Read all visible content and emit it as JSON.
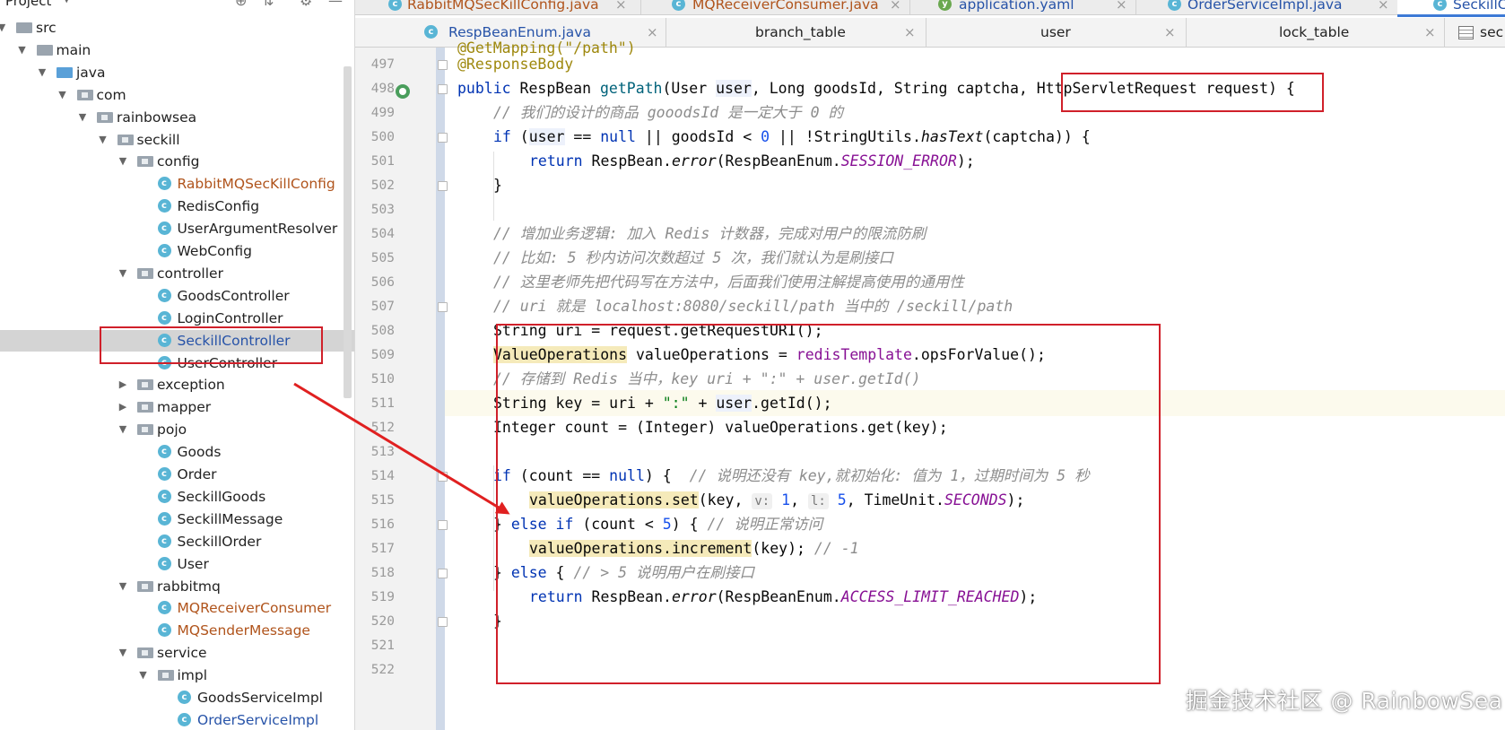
{
  "tree": {
    "header_label": "Project",
    "items": [
      {
        "label": "src",
        "type": "folder"
      },
      {
        "label": "main",
        "type": "folder"
      },
      {
        "label": "java",
        "type": "folder"
      },
      {
        "label": "com",
        "type": "package"
      },
      {
        "label": "rainbowsea",
        "type": "package"
      },
      {
        "label": "seckill",
        "type": "package"
      },
      {
        "label": "config",
        "type": "package"
      },
      {
        "label": "RabbitMQSecKillConfig",
        "type": "class"
      },
      {
        "label": "RedisConfig",
        "type": "class"
      },
      {
        "label": "UserArgumentResolver",
        "type": "class"
      },
      {
        "label": "WebConfig",
        "type": "class"
      },
      {
        "label": "controller",
        "type": "package"
      },
      {
        "label": "GoodsController",
        "type": "class"
      },
      {
        "label": "LoginController",
        "type": "class"
      },
      {
        "label": "SeckillController",
        "type": "class"
      },
      {
        "label": "UserController",
        "type": "class"
      },
      {
        "label": "exception",
        "type": "package"
      },
      {
        "label": "mapper",
        "type": "package"
      },
      {
        "label": "pojo",
        "type": "package"
      },
      {
        "label": "Goods",
        "type": "class"
      },
      {
        "label": "Order",
        "type": "class"
      },
      {
        "label": "SeckillGoods",
        "type": "class"
      },
      {
        "label": "SeckillMessage",
        "type": "class"
      },
      {
        "label": "SeckillOrder",
        "type": "class"
      },
      {
        "label": "User",
        "type": "class"
      },
      {
        "label": "rabbitmq",
        "type": "package"
      },
      {
        "label": "MQReceiverConsumer",
        "type": "class"
      },
      {
        "label": "MQSenderMessage",
        "type": "class"
      },
      {
        "label": "service",
        "type": "package"
      },
      {
        "label": "impl",
        "type": "package"
      },
      {
        "label": "GoodsServiceImpl",
        "type": "class"
      },
      {
        "label": "OrderServiceImpl",
        "type": "class"
      }
    ]
  },
  "tabs_top": [
    "RabbitMQSecKillConfig.java",
    "MQReceiverConsumer.java",
    "application.yaml",
    "OrderServiceImpl.java",
    "SeckillC"
  ],
  "tabs_bottom": [
    "RespBeanEnum.java",
    "branch_table",
    "user",
    "lock_table",
    "sec"
  ],
  "icon_letter": "c",
  "gutter": {
    "line_numbers": [
      "497",
      "498",
      "499",
      "500",
      "501",
      "502",
      "503",
      "504",
      "505",
      "506",
      "507",
      "508",
      "509",
      "510",
      "511",
      "512",
      "513",
      "514",
      "515",
      "516",
      "517",
      "518",
      "519",
      "520",
      "521",
      "522"
    ]
  },
  "code": {
    "l497": "@ResponseBody",
    "l498_public": "public",
    "l498_a": " RespBean ",
    "l498_fn": "getPath",
    "l498_b": "(User ",
    "l498_user": "user",
    "l498_c": ", Long goodsId, String captcha, HttpServletRequest request) {",
    "l499": "// 我们的设计的商品 gooodsId 是一定大于 0 的",
    "l500_if": "if",
    "l500_a": " (",
    "l500_user": "user",
    "l500_b": " == ",
    "l500_null": "null",
    "l500_c": " || goodsId < ",
    "l500_zero": "0",
    "l500_d": " || !StringUtils.",
    "l500_fn": "hasText",
    "l500_e": "(captcha)) {",
    "l501_return": "return",
    "l501_a": " RespBean.",
    "l501_fn": "error",
    "l501_b": "(RespBeanEnum.",
    "l501_const": "SESSION_ERROR",
    "l501_c": ");",
    "l502": "}",
    "l504": "// 增加业务逻辑: 加入 Redis 计数器，完成对用户的限流防刷",
    "l505": "// 比如: 5 秒内访问次数超过 5 次，我们就认为是刷接口",
    "l506": "// 这里老师先把代码写在方法中，后面我们使用注解提高使用的通用性",
    "l507": "// uri 就是 localhost:8080/seckill/path 当中的 /seckill/path",
    "l508": "String uri = request.getRequestURI();",
    "l509_type": "ValueOperations",
    "l509_a": " valueOperations = ",
    "l509_field": "redisTemplate",
    "l509_b": ".opsForValue();",
    "l510": "// 存储到 Redis 当中，key uri + \":\" + user.getId()",
    "l511_a": "String key = uri + ",
    "l511_str": "\":\"",
    "l511_b": " + ",
    "l511_user": "user",
    "l511_c": ".getId();",
    "l512": "Integer count = (Integer) valueOperations.get(key);",
    "l514_if": "if",
    "l514_a": " (count == ",
    "l514_null": "null",
    "l514_b": ") {  ",
    "l514_cm": "// 说明还没有 key,就初始化: 值为 1，过期时间为 5 秒",
    "l515_call": "valueOperations.set",
    "l515_a": "(key, ",
    "l515_hint_v": "v:",
    "l515_one": " 1",
    "l515_b": ", ",
    "l515_hint_l": "l:",
    "l515_five": " 5",
    "l515_c": ", TimeUnit.",
    "l515_const": "SECONDS",
    "l515_d": ");",
    "l516_a": "} ",
    "l516_else": "else if",
    "l516_b": " (count < ",
    "l516_five": "5",
    "l516_c": ") { ",
    "l516_cm": "// 说明正常访问",
    "l517_call": "valueOperations.increment",
    "l517_a": "(key); ",
    "l517_cm": "// -1",
    "l518_a": "} ",
    "l518_else": "else",
    "l518_b": " { ",
    "l518_cm": "// > 5 说明用户在刷接口",
    "l519_return": "return",
    "l519_a": " RespBean.",
    "l519_fn": "error",
    "l519_b": "(RespBeanEnum.",
    "l519_const": "ACCESS_LIMIT_REACHED",
    "l519_c": ");",
    "l520": "}"
  },
  "watermark": "掘金技术社区 @ RainbowSea",
  "colors": {
    "annotation_box": "#d0202a",
    "keyword": "#0033b3",
    "comment": "#8c8c8c",
    "constant": "#871094"
  }
}
